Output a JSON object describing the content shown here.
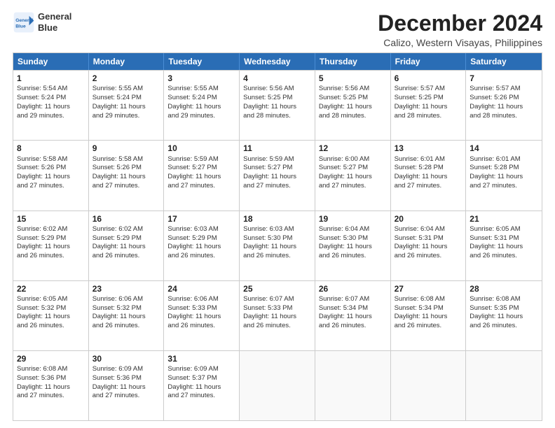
{
  "logo": {
    "line1": "General",
    "line2": "Blue"
  },
  "title": "December 2024",
  "subtitle": "Calizo, Western Visayas, Philippines",
  "days_of_week": [
    "Sunday",
    "Monday",
    "Tuesday",
    "Wednesday",
    "Thursday",
    "Friday",
    "Saturday"
  ],
  "weeks": [
    [
      {
        "day": "1",
        "lines": [
          "Sunrise: 5:54 AM",
          "Sunset: 5:24 PM",
          "Daylight: 11 hours",
          "and 29 minutes."
        ]
      },
      {
        "day": "2",
        "lines": [
          "Sunrise: 5:55 AM",
          "Sunset: 5:24 PM",
          "Daylight: 11 hours",
          "and 29 minutes."
        ]
      },
      {
        "day": "3",
        "lines": [
          "Sunrise: 5:55 AM",
          "Sunset: 5:24 PM",
          "Daylight: 11 hours",
          "and 29 minutes."
        ]
      },
      {
        "day": "4",
        "lines": [
          "Sunrise: 5:56 AM",
          "Sunset: 5:25 PM",
          "Daylight: 11 hours",
          "and 28 minutes."
        ]
      },
      {
        "day": "5",
        "lines": [
          "Sunrise: 5:56 AM",
          "Sunset: 5:25 PM",
          "Daylight: 11 hours",
          "and 28 minutes."
        ]
      },
      {
        "day": "6",
        "lines": [
          "Sunrise: 5:57 AM",
          "Sunset: 5:25 PM",
          "Daylight: 11 hours",
          "and 28 minutes."
        ]
      },
      {
        "day": "7",
        "lines": [
          "Sunrise: 5:57 AM",
          "Sunset: 5:26 PM",
          "Daylight: 11 hours",
          "and 28 minutes."
        ]
      }
    ],
    [
      {
        "day": "8",
        "lines": [
          "Sunrise: 5:58 AM",
          "Sunset: 5:26 PM",
          "Daylight: 11 hours",
          "and 27 minutes."
        ]
      },
      {
        "day": "9",
        "lines": [
          "Sunrise: 5:58 AM",
          "Sunset: 5:26 PM",
          "Daylight: 11 hours",
          "and 27 minutes."
        ]
      },
      {
        "day": "10",
        "lines": [
          "Sunrise: 5:59 AM",
          "Sunset: 5:27 PM",
          "Daylight: 11 hours",
          "and 27 minutes."
        ]
      },
      {
        "day": "11",
        "lines": [
          "Sunrise: 5:59 AM",
          "Sunset: 5:27 PM",
          "Daylight: 11 hours",
          "and 27 minutes."
        ]
      },
      {
        "day": "12",
        "lines": [
          "Sunrise: 6:00 AM",
          "Sunset: 5:27 PM",
          "Daylight: 11 hours",
          "and 27 minutes."
        ]
      },
      {
        "day": "13",
        "lines": [
          "Sunrise: 6:01 AM",
          "Sunset: 5:28 PM",
          "Daylight: 11 hours",
          "and 27 minutes."
        ]
      },
      {
        "day": "14",
        "lines": [
          "Sunrise: 6:01 AM",
          "Sunset: 5:28 PM",
          "Daylight: 11 hours",
          "and 27 minutes."
        ]
      }
    ],
    [
      {
        "day": "15",
        "lines": [
          "Sunrise: 6:02 AM",
          "Sunset: 5:29 PM",
          "Daylight: 11 hours",
          "and 26 minutes."
        ]
      },
      {
        "day": "16",
        "lines": [
          "Sunrise: 6:02 AM",
          "Sunset: 5:29 PM",
          "Daylight: 11 hours",
          "and 26 minutes."
        ]
      },
      {
        "day": "17",
        "lines": [
          "Sunrise: 6:03 AM",
          "Sunset: 5:29 PM",
          "Daylight: 11 hours",
          "and 26 minutes."
        ]
      },
      {
        "day": "18",
        "lines": [
          "Sunrise: 6:03 AM",
          "Sunset: 5:30 PM",
          "Daylight: 11 hours",
          "and 26 minutes."
        ]
      },
      {
        "day": "19",
        "lines": [
          "Sunrise: 6:04 AM",
          "Sunset: 5:30 PM",
          "Daylight: 11 hours",
          "and 26 minutes."
        ]
      },
      {
        "day": "20",
        "lines": [
          "Sunrise: 6:04 AM",
          "Sunset: 5:31 PM",
          "Daylight: 11 hours",
          "and 26 minutes."
        ]
      },
      {
        "day": "21",
        "lines": [
          "Sunrise: 6:05 AM",
          "Sunset: 5:31 PM",
          "Daylight: 11 hours",
          "and 26 minutes."
        ]
      }
    ],
    [
      {
        "day": "22",
        "lines": [
          "Sunrise: 6:05 AM",
          "Sunset: 5:32 PM",
          "Daylight: 11 hours",
          "and 26 minutes."
        ]
      },
      {
        "day": "23",
        "lines": [
          "Sunrise: 6:06 AM",
          "Sunset: 5:32 PM",
          "Daylight: 11 hours",
          "and 26 minutes."
        ]
      },
      {
        "day": "24",
        "lines": [
          "Sunrise: 6:06 AM",
          "Sunset: 5:33 PM",
          "Daylight: 11 hours",
          "and 26 minutes."
        ]
      },
      {
        "day": "25",
        "lines": [
          "Sunrise: 6:07 AM",
          "Sunset: 5:33 PM",
          "Daylight: 11 hours",
          "and 26 minutes."
        ]
      },
      {
        "day": "26",
        "lines": [
          "Sunrise: 6:07 AM",
          "Sunset: 5:34 PM",
          "Daylight: 11 hours",
          "and 26 minutes."
        ]
      },
      {
        "day": "27",
        "lines": [
          "Sunrise: 6:08 AM",
          "Sunset: 5:34 PM",
          "Daylight: 11 hours",
          "and 26 minutes."
        ]
      },
      {
        "day": "28",
        "lines": [
          "Sunrise: 6:08 AM",
          "Sunset: 5:35 PM",
          "Daylight: 11 hours",
          "and 26 minutes."
        ]
      }
    ],
    [
      {
        "day": "29",
        "lines": [
          "Sunrise: 6:08 AM",
          "Sunset: 5:36 PM",
          "Daylight: 11 hours",
          "and 27 minutes."
        ]
      },
      {
        "day": "30",
        "lines": [
          "Sunrise: 6:09 AM",
          "Sunset: 5:36 PM",
          "Daylight: 11 hours",
          "and 27 minutes."
        ]
      },
      {
        "day": "31",
        "lines": [
          "Sunrise: 6:09 AM",
          "Sunset: 5:37 PM",
          "Daylight: 11 hours",
          "and 27 minutes."
        ]
      },
      {
        "day": "",
        "lines": []
      },
      {
        "day": "",
        "lines": []
      },
      {
        "day": "",
        "lines": []
      },
      {
        "day": "",
        "lines": []
      }
    ]
  ]
}
